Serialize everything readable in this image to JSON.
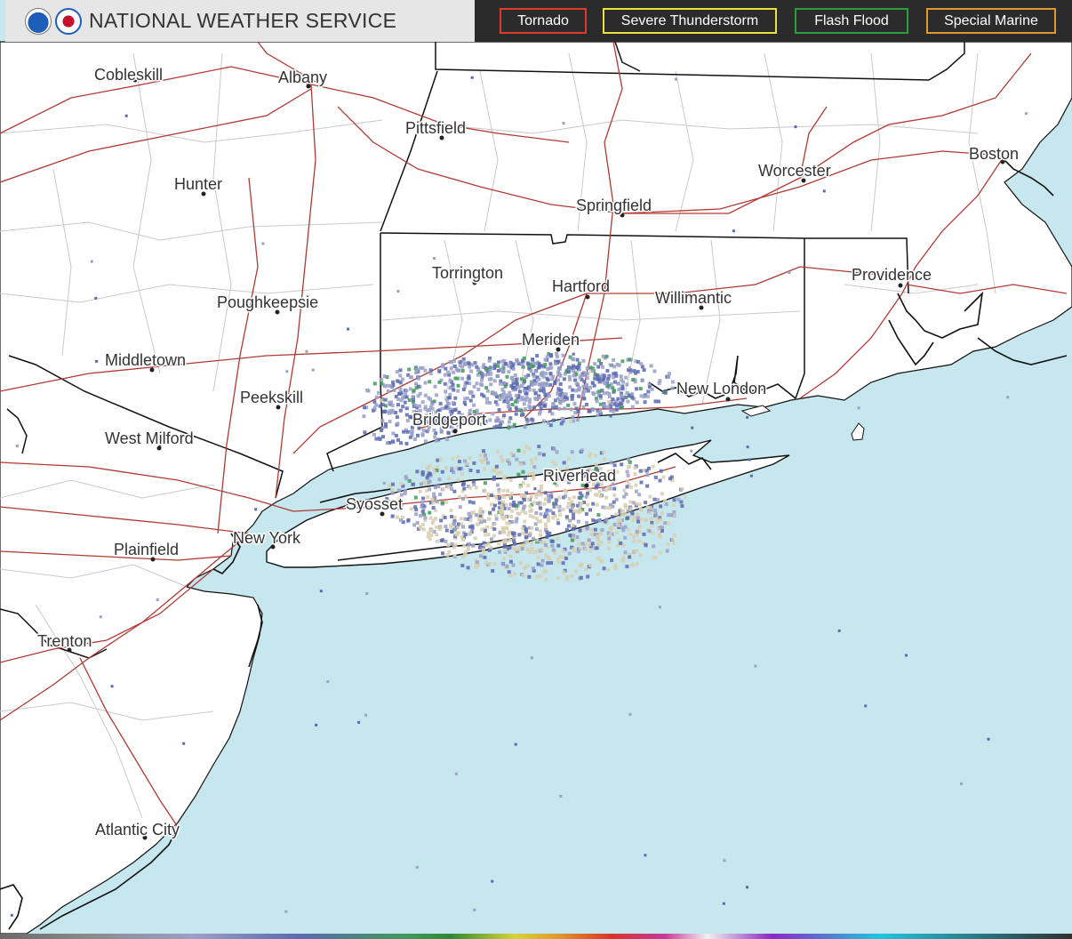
{
  "header": {
    "site_title": "NATIONAL WEATHER SERVICE",
    "logos": [
      "noaa-logo",
      "nws-logo"
    ]
  },
  "legend": {
    "tornado": {
      "label": "Tornado",
      "color": "#e03a2e"
    },
    "severe_thunderstorm": {
      "label": "Severe Thunderstorm",
      "color": "#e8e23a"
    },
    "flash_flood": {
      "label": "Flash Flood",
      "color": "#2e9c3c"
    },
    "special_marine": {
      "label": "Special Marine",
      "color": "#e0982e"
    }
  },
  "map": {
    "land_color": "#ffffff",
    "water_color": "#c7e7ef",
    "road_color": "#b03a34",
    "state_border_color": "#111111",
    "county_border_color": "#c9c9c9",
    "radar_colors": [
      "#9aa0c8",
      "#5b6ab0",
      "#3e9a5a",
      "#d8cfb0"
    ],
    "cities": {
      "cobleskill": "Cobleskill",
      "albany": "Albany",
      "pittsfield": "Pittsfield",
      "hunter": "Hunter",
      "worcester": "Worcester",
      "boston": "Boston",
      "springfield": "Springfield",
      "torrington": "Torrington",
      "hartford": "Hartford",
      "willimantic": "Willimantic",
      "providence": "Providence",
      "poughkeepsie": "Poughkeepsie",
      "meriden": "Meriden",
      "middletown": "Middletown",
      "new_london": "New London",
      "peekskill": "Peekskill",
      "bridgeport": "Bridgeport",
      "west_milford": "West Milford",
      "riverhead": "Riverhead",
      "syosset": "Syosset",
      "new_york": "New York",
      "plainfield": "Plainfield",
      "trenton": "Trenton",
      "atlantic_city": "Atlantic City"
    }
  }
}
